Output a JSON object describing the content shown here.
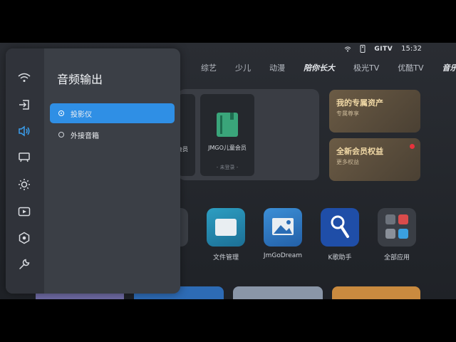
{
  "status": {
    "time": "15:32",
    "tv_badge": "GITV"
  },
  "nav": {
    "tabs": [
      "综艺",
      "少儿",
      "动漫",
      "陪你长大",
      "极光TV",
      "优酷TV",
      "音乐"
    ]
  },
  "hero": {
    "member_card_partial": "会员",
    "kids_card_label": "JMGO儿童会员",
    "kids_card_status": "- 未登录 -",
    "promo1_title": "我的专属资产",
    "promo1_sub": "专属尊享",
    "promo2_title": "全新会员权益",
    "promo2_sub": "更多权益"
  },
  "apps": [
    {
      "label": "文件管理"
    },
    {
      "label": "JmGoDream"
    },
    {
      "label": "K歌助手"
    },
    {
      "label": "全部应用"
    }
  ],
  "settings": {
    "title": "音频输出",
    "options": [
      {
        "label": "投影仪",
        "selected": true
      },
      {
        "label": "外接音箱",
        "selected": false
      }
    ],
    "rail_icons": [
      "wifi-icon",
      "input-source-icon",
      "audio-icon",
      "projector-icon",
      "brightness-icon",
      "play-icon",
      "settings-hex-icon",
      "wrench-icon"
    ]
  },
  "colors": {
    "accent": "#2f8fe5",
    "panel": "#3b3f46",
    "rail": "#30333a"
  }
}
